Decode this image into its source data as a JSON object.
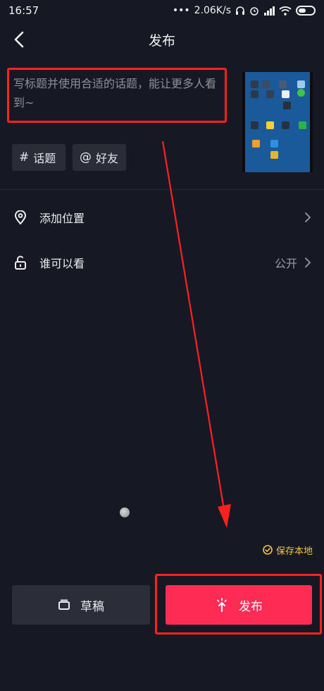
{
  "status_bar": {
    "time": "16:57",
    "network_speed": "2.06K/s",
    "icons": [
      "dots-icon",
      "headphone-icon",
      "alarm-icon",
      "signal-icon",
      "wifi-icon",
      "battery-icon"
    ]
  },
  "header": {
    "title": "发布",
    "back_icon": "chevron-left-icon"
  },
  "caption": {
    "placeholder": "写标题并使用合适的话题，能让更多人看到~",
    "highlight_color": "#ff2020"
  },
  "tags": [
    {
      "symbol": "#",
      "label": "话题",
      "icon": "hashtag-icon"
    },
    {
      "symbol": "@",
      "label": "好友",
      "icon": "at-icon"
    }
  ],
  "settings": [
    {
      "label": "添加位置",
      "value": "",
      "icon": "location-pin-icon"
    },
    {
      "label": "谁可以看",
      "value": "公开",
      "icon": "unlock-icon"
    }
  ],
  "save_local": {
    "label": "保存本地",
    "checked": true,
    "color": "#f4c542"
  },
  "actions": {
    "draft_label": "草稿",
    "publish_label": "发布",
    "publish_color": "#fe2c55"
  },
  "annotation": {
    "arrow_color": "#ff2020"
  }
}
